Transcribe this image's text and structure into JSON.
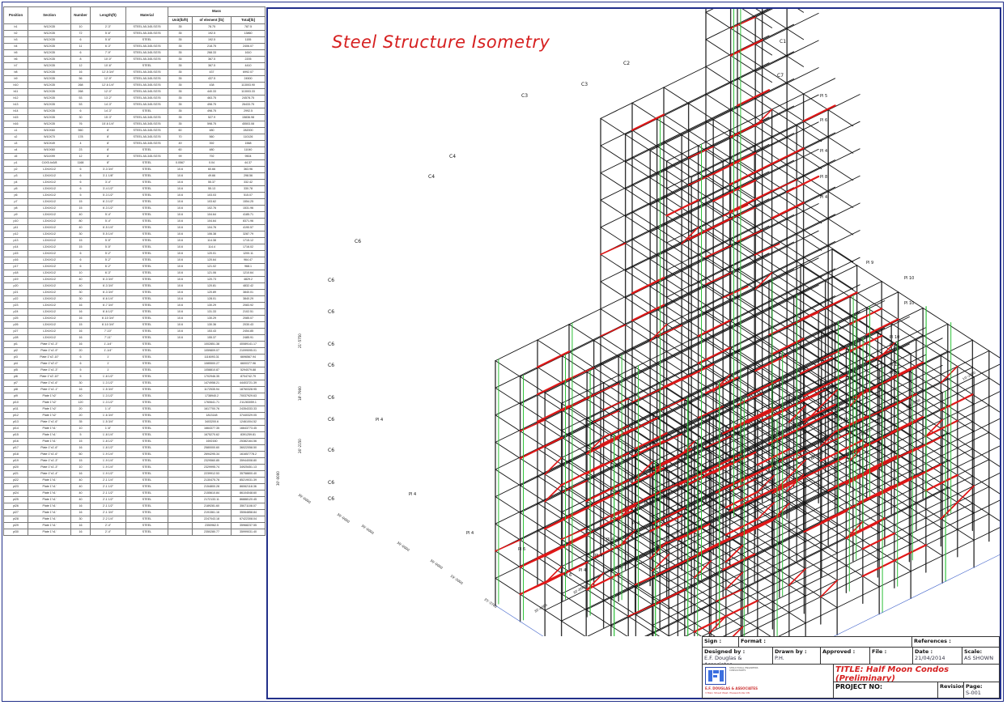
{
  "bom": {
    "headers": {
      "position": "Position",
      "section": "Section",
      "number": "Number",
      "length": "Length(ft)",
      "material": "Material",
      "mass": "Mass",
      "unit": "Unit(lb/ft)",
      "per_element": "of element [lb]",
      "total": "Total[lb]"
    },
    "rows": [
      [
        "b1",
        "W12X35",
        "10",
        "2'-3\"",
        "STEEL A5-345-SG76",
        "35",
        "78.75",
        "787.5"
      ],
      [
        "b2",
        "W12X35",
        "72",
        "5'-6\"",
        "STEEL A5-345-SG76",
        "35",
        "192.5",
        "13860"
      ],
      [
        "b3",
        "W12X35",
        "6",
        "5'-6\"",
        "STEEL",
        "35",
        "192.5",
        "1155"
      ],
      [
        "b4",
        "W12X35",
        "11",
        "6'-3\"",
        "STEEL A5-345-SG76",
        "35",
        "218.75",
        "2406.07"
      ],
      [
        "b5",
        "W12X35",
        "6",
        "7'-9\"",
        "STEEL A5-345-SG76",
        "35",
        "268.33",
        "1610"
      ],
      [
        "b6",
        "W12X35",
        "8",
        "10'-0\"",
        "STEEL A5-345-SG76",
        "35",
        "367.5",
        "2205"
      ],
      [
        "b7",
        "W12X35",
        "12",
        "10'-6\"",
        "STEEL",
        "35",
        "367.5",
        "4410"
      ],
      [
        "b8",
        "W12X35",
        "16",
        "12'-5 3/4\"",
        "STEEL A5-345-SG76",
        "35",
        "437",
        "6992.07"
      ],
      [
        "b9",
        "W12X35",
        "56",
        "12'-9\"",
        "STEEL A5-345-SG76",
        "35",
        "437.5",
        "24500"
      ],
      [
        "b10",
        "W12X35",
        "268",
        "12'-6 1/4\"",
        "STEEL A5-345-SG76",
        "35",
        "438",
        "113003.90"
      ],
      [
        "b11",
        "W12X35",
        "268",
        "12'-0\"",
        "STEEL A5-345-SG76",
        "35",
        "440.33",
        "113003.33"
      ],
      [
        "b12",
        "W12X35",
        "53",
        "13'-2\"",
        "STEEL A5-345-SG76",
        "35",
        "463.75",
        "24578.75"
      ],
      [
        "b13",
        "W12X35",
        "53",
        "14'-3\"",
        "STEEL A5-345-SG76",
        "35",
        "498.75",
        "26433.75"
      ],
      [
        "b14",
        "W12X35",
        "6",
        "14'-3\"",
        "STEEL",
        "35",
        "498.75",
        "2992.5"
      ],
      [
        "b15",
        "W12X35",
        "30",
        "15'-3\"",
        "STEEL A5-345-SG76",
        "35",
        "527.9",
        "15836.98"
      ],
      [
        "b16",
        "W12X35",
        "76",
        "15'-6 1/4\"",
        "STEEL A5-345-SG76",
        "35",
        "598.75",
        "45503.08"
      ],
      [
        "c1",
        "W10X60",
        "560",
        "8'",
        "STEEL A5-345-SG76",
        "60",
        "480",
        "282000"
      ],
      [
        "c2",
        "W10X70",
        "178",
        "8'",
        "STEEL A5-345-SG76",
        "70",
        "560",
        "110126"
      ],
      [
        "c3",
        "W10X49",
        "4",
        "8'",
        "STEEL A5-345-SG76",
        "49",
        "392",
        "1568"
      ],
      [
        "c4",
        "W10X60",
        "23",
        "8'",
        "STEEL",
        "60",
        "480",
        "11040"
      ],
      [
        "c5",
        "W14X99",
        "12",
        "8'",
        "STEEL A5-345-SG76",
        "99",
        "792",
        "9504"
      ],
      [
        "p1",
        "C4X5.4x3/8",
        "1168",
        "8\"",
        "STEEL",
        "0.0567",
        "0.04",
        "44.37"
      ],
      [
        "p2",
        "L3X4X1/2",
        "6",
        "3'-3 3/4\"",
        "STEEL",
        "10.6",
        "60.66",
        "363.96"
      ],
      [
        "p3",
        "L3X4X1/2",
        "6",
        "3'-1 1/8\"",
        "STEEL",
        "10.6",
        "49.66",
        "298.56"
      ],
      [
        "p4",
        "L3X4X1/2",
        "6",
        "3'-4\"",
        "STEEL",
        "10.6",
        "55.37",
        "332.42"
      ],
      [
        "p5",
        "L3X4X1/2",
        "6",
        "3'-4 1/2\"",
        "STEEL",
        "10.6",
        "55.13",
        "330.78"
      ],
      [
        "p6",
        "L3X4X1/2",
        "5",
        "5'-3 1/2\"",
        "STEEL",
        "10.6",
        "103.03",
        "515.07"
      ],
      [
        "p7",
        "L3X4X1/2",
        "15",
        "6'-3 1/2\"",
        "STEEL",
        "10.6",
        "103.62",
        "1554.25"
      ],
      [
        "p8",
        "L3X4X1/2",
        "15",
        "6'-3 1/2\"",
        "STEEL",
        "10.6",
        "102.76",
        "1531.96"
      ],
      [
        "p9",
        "L3X4X1/2",
        "40",
        "5'-4\"",
        "STEEL",
        "10.6",
        "104.64",
        "4185.71"
      ],
      [
        "p10",
        "L3X4X1/2",
        "80",
        "5'-4\"",
        "STEEL",
        "10.6",
        "104.64",
        "8371.96"
      ],
      [
        "p11",
        "L3X4X1/2",
        "40",
        "6'-5 1/4\"",
        "STEEL",
        "10.6",
        "104.76",
        "4190.57"
      ],
      [
        "p12",
        "L3X4X1/2",
        "30",
        "5'-5 1/4\"",
        "STEEL",
        "10.6",
        "106.38",
        "3287.79"
      ],
      [
        "p13",
        "L3X4X1/2",
        "15",
        "5'-5\"",
        "STEEL",
        "10.6",
        "114.38",
        "1715.12"
      ],
      [
        "p14",
        "L3X4X1/2",
        "15",
        "5'-5\"",
        "STEEL",
        "10.6",
        "114.4",
        "1716.02"
      ],
      [
        "p15",
        "L3X4X1/2",
        "6",
        "5'-2\"",
        "STEEL",
        "10.6",
        "120.01",
        "1200.11"
      ],
      [
        "p16",
        "L3X4X1/2",
        "6",
        "5'-2\"",
        "STEEL",
        "10.6",
        "120.64",
        "964.47"
      ],
      [
        "p17",
        "L3X4X1/2",
        "6",
        "6'-2\"",
        "STEEL",
        "10.6",
        "121.02",
        "968.1"
      ],
      [
        "p18",
        "L3X4X1/2",
        "10",
        "6'-3\"",
        "STEEL",
        "10.6",
        "121.06",
        "1210.64"
      ],
      [
        "p19",
        "L3X4X1/2",
        "40",
        "6'-3 3/4\"",
        "STEEL",
        "10.6",
        "120.73",
        "4829.2"
      ],
      [
        "p20",
        "L3X4X1/2",
        "40",
        "6'-3 3/4\"",
        "STEEL",
        "10.6",
        "120.81",
        "4832.42"
      ],
      [
        "p21",
        "L3X4X1/2",
        "30",
        "6'-3 3/4\"",
        "STEEL",
        "10.6",
        "120.89",
        "3840.01"
      ],
      [
        "p22",
        "L3X4X1/2",
        "30",
        "6'-6 1/4\"",
        "STEEL",
        "10.6",
        "128.01",
        "3840.29"
      ],
      [
        "p23",
        "L3X4X1/2",
        "16",
        "6'-7 3/4\"",
        "STEEL",
        "10.6",
        "130.29",
        "2083.92"
      ],
      [
        "p24",
        "L3X4X1/2",
        "16",
        "6'-6 1/2\"",
        "STEEL",
        "10.6",
        "131.33",
        "2102.51"
      ],
      [
        "p25",
        "L3X4X1/2",
        "16",
        "6'-10 3/4\"",
        "STEEL",
        "10.6",
        "130.29",
        "2085.07"
      ],
      [
        "p26",
        "L3X4X1/2",
        "15",
        "6'-10 3/4\"",
        "STEEL",
        "10.6",
        "130.36",
        "2030.43"
      ],
      [
        "p27",
        "L3X4X1/2",
        "16",
        "7'-10\"",
        "STEEL",
        "10.6",
        "153.43",
        "2454.85"
      ],
      [
        "p28",
        "L3X4X1/2",
        "16",
        "7'-11\"",
        "STEEL",
        "10.6",
        "155.37",
        "2485.91"
      ],
      [
        "pl1",
        "Plate 1\"x1'-3\"",
        "16",
        "1'-1/4\"",
        "STEEL",
        "",
        "1002851.38",
        "40089141.17"
      ],
      [
        "pl2",
        "Plate 1\"x1'-9\"",
        "20",
        "1'-1/4\"",
        "STEEL",
        "",
        "1059809.07",
        "21099095.01"
      ],
      [
        "pl3",
        "Plate 1\"x2'-10\"",
        "6",
        "1'",
        "STEEL",
        "",
        "1116093.31",
        "6696567.94"
      ],
      [
        "pl4",
        "Plate 1\"x2'-0\"",
        "6",
        "1'",
        "STEEL",
        "",
        "1085500.27",
        "6600377.96"
      ],
      [
        "pl5",
        "Plate 1\"x1'-3\"",
        "5",
        "1'",
        "STEEL",
        "",
        "1058810.87",
        "5294079.88"
      ],
      [
        "pl6",
        "Plate 1\"x2'-10\"",
        "5",
        "1'-8 1/2\"",
        "STEEL",
        "",
        "1702946.35",
        "8704742.79"
      ],
      [
        "pl7",
        "Plate 1\"x1'-6\"",
        "30",
        "1'-3 1/2\"",
        "STEEL",
        "",
        "1474958.21",
        "44403721.39"
      ],
      [
        "pl8",
        "Plate 1\"x1'-1\"",
        "16",
        "1'-5 3/4\"",
        "STEEL",
        "",
        "1172535.94",
        "18760328.95"
      ],
      [
        "pl9",
        "Plate 1\"x2'",
        "40",
        "1'-3 1/2\"",
        "STEEL",
        "",
        "1738940.2",
        "70037929.63"
      ],
      [
        "pl10",
        "Plate 1\"x2'",
        "120",
        "1'-3 1/2\"",
        "STEEL",
        "",
        "1760641.71",
        "211283059.1"
      ],
      [
        "pl11",
        "Plate 1\"x2'",
        "20",
        "1'-4\"",
        "STEEL",
        "",
        "1617700.76",
        "24354333.33"
      ],
      [
        "pl12",
        "Plate 1\"x2'",
        "20",
        "1'-6 3/4\"",
        "STEEL",
        "",
        "1813148",
        "37440329.05"
      ],
      [
        "pl13",
        "Plate 1\"x1'-6\"",
        "35",
        "1'-5 3/4\"",
        "STEEL",
        "",
        "3403200.6",
        "12461004.52"
      ],
      [
        "pl14",
        "Plate 1\"x1'",
        "10",
        "1'-6\"",
        "STEEL",
        "",
        "1664377.35",
        "16643773.45"
      ],
      [
        "pl15",
        "Plate 1\"x1'",
        "5",
        "1'-8 1/4\"",
        "STEEL",
        "",
        "1675270.62",
        "8391259.81"
      ],
      [
        "pl16",
        "Plate 1\"x1'",
        "15",
        "1'-8 1/2\"",
        "STEEL",
        "",
        "1692160",
        "25382164.56"
      ],
      [
        "pl17",
        "Plate 1\"x1'-6\"",
        "16",
        "1'-8 1/2\"",
        "STEEL",
        "",
        "2580000.60",
        "36022058.50"
      ],
      [
        "pl18",
        "Plate 1\"x1'-6\"",
        "60",
        "1'-9 1/4\"",
        "STEEL",
        "",
        "2694295.34",
        "161657778.2"
      ],
      [
        "pl19",
        "Plate 1\"x1'-3\"",
        "15",
        "1'-9 1/4\"",
        "STEEL",
        "",
        "2329560.85",
        "35944008.80"
      ],
      [
        "pl20",
        "Plate 1\"x1'-3\"",
        "10",
        "1'-9 1/4\"",
        "STEEL",
        "",
        "2329995.74",
        "34925451.13"
      ],
      [
        "pl21",
        "Plate 1\"x1'-4\"",
        "16",
        "1'-9 1/2\"",
        "STEEL",
        "",
        "2239912.53",
        "35758800.40"
      ],
      [
        "pl22",
        "Plate 1\"x1'",
        "40",
        "2'-1 1/4\"",
        "STEEL",
        "",
        "2130475.78",
        "85219031.39"
      ],
      [
        "pl23",
        "Plate 1\"x1'",
        "40",
        "2'-1 1/2\"",
        "STEEL",
        "",
        "2154800.28",
        "86062118.36"
      ],
      [
        "pl24",
        "Plate 1\"x1'",
        "40",
        "2'-1 1/2\"",
        "STEEL",
        "",
        "2155610.84",
        "86104048.60"
      ],
      [
        "pl25",
        "Plate 1\"x1'",
        "40",
        "2'-1 1/2\"",
        "STEEL",
        "",
        "2172133.11",
        "86888120.45"
      ],
      [
        "pl26",
        "Plate 1\"x1'",
        "16",
        "2'-1 1/2\"",
        "STEEL",
        "",
        "2189281.60",
        "35071108.07"
      ],
      [
        "pl27",
        "Plate 1\"x1'",
        "16",
        "2'-1 3/4\"",
        "STEEL",
        "",
        "2191561.16",
        "35064858.84"
      ],
      [
        "pl28",
        "Plate 1\"x1'",
        "30",
        "2'-2 1/4\"",
        "STEEL",
        "",
        "2247043.18",
        "67422308.04"
      ],
      [
        "pl29",
        "Plate 1\"x1'",
        "16",
        "2'-4\"",
        "STEEL",
        "",
        "2350962.5",
        "35968237.55"
      ],
      [
        "pl30",
        "Plate 1\"x1'",
        "16",
        "2'-4\"",
        "STEEL",
        "",
        "2350280.77",
        "35999031.40"
      ]
    ]
  },
  "drawing": {
    "title": "Steel Structure Isometry",
    "colors": {
      "steel": "#111111",
      "member_red": "#e01818",
      "member_green": "#2ec23a",
      "frame": "#22308a"
    },
    "column_labels": [
      "C1",
      "C2",
      "C3",
      "C3",
      "C4",
      "C4",
      "C6",
      "C6",
      "C6",
      "C6",
      "C6",
      "C6",
      "C6",
      "C6",
      "C6",
      "C6",
      "C7"
    ],
    "plate_labels": [
      "Pl 4",
      "Pl 4",
      "Pl 5",
      "Pl 6",
      "Pl 8",
      "Pl 9",
      "Pl 10",
      "Pl 10",
      "Pl 10",
      "Pl 11",
      "Pl 12",
      "Pl 13",
      "Pl 13",
      "Pl 14",
      "Pl 15",
      "Pl 16",
      "Pl 1",
      "Pl 2",
      "Pl 3",
      "Pl 4",
      "Pl 4",
      "Pl 4",
      "Pl 4",
      "Pl 6",
      "Pl 6",
      "Pl 4",
      "Pl 4",
      "Pl 4"
    ],
    "dimensions": [
      "19'-2000",
      "146'-9000",
      "146'-9000",
      "146'-9000",
      "146'-9000",
      "146'-9000",
      "146'-9000",
      "30'-0000",
      "30'-0000",
      "30'-0000",
      "30'-0000",
      "30'-0000",
      "30'-0000",
      "30'-0000",
      "30'-0000",
      "30'-0000",
      "19'-3000",
      "25'-3700",
      "26'-2150",
      "18'-7900",
      "21'-5750"
    ]
  },
  "titleblock": {
    "sign_label": "Sign :",
    "format_label": "Format :",
    "references_label": "References :",
    "designed_by_label": "Designed by :",
    "designed_by_value": "E.F. Douglas & Associates",
    "drawn_by_label": "Drawn by :",
    "drawn_by_value": "P.H.",
    "approved_label": "Approved :",
    "file_label": "File :",
    "date_label": "Date :",
    "date_value": "21/04/2014",
    "scale_label": "Scale:",
    "scale_value": "AS SHOWN",
    "title": "TITLE: Half Moon Condos (Preliminary)",
    "project_no_label": "PROJECT NO:",
    "revision_label": "Revision",
    "page_label": "Page:",
    "page_value": "S-001",
    "logo_name": "E.F. DOUGLAS & ASSOCIATES",
    "logo_tagline": "STRUCTURAL ENGINEERS CONSULTANTS",
    "logo_address": "3 Main Street West, Pleasantville ON"
  }
}
